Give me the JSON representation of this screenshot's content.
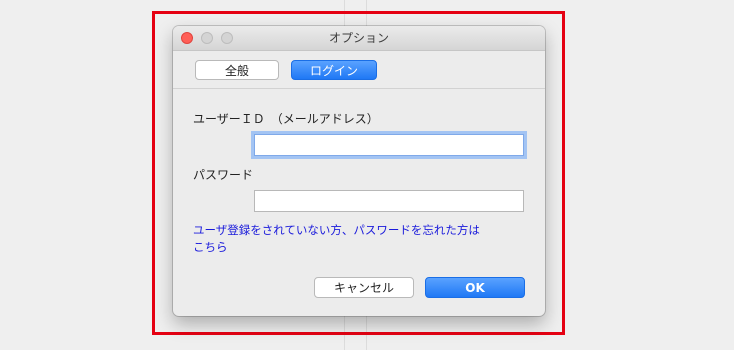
{
  "window": {
    "title": "オプション"
  },
  "tabs": [
    {
      "label": "全般",
      "selected": false
    },
    {
      "label": "ログイン",
      "selected": true
    }
  ],
  "form": {
    "user_id_label": "ユーザーＩＤ　（メールアドレス）",
    "user_id_value": "",
    "password_label": "パスワード",
    "password_value": "",
    "help_link_line1": "ユーザ登録をされていない方、パスワードを忘れた方は",
    "help_link_line2": "こちら"
  },
  "buttons": {
    "cancel_label": "キャンセル",
    "ok_label": "OK"
  },
  "colors": {
    "highlight_border": "#e50012",
    "accent_blue": "#1f78f5",
    "link_blue": "#1a1adb",
    "close_button": "#ff5f57"
  }
}
